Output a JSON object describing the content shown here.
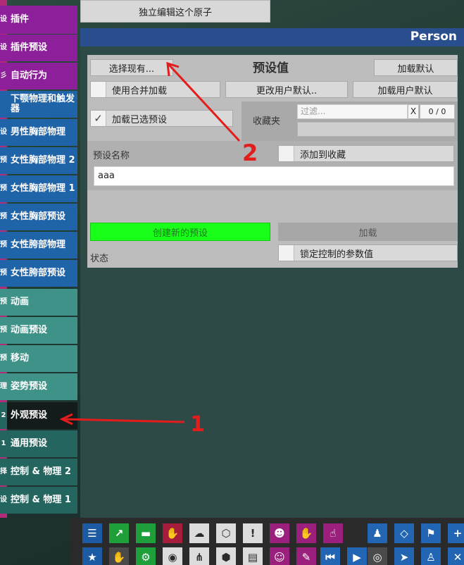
{
  "sidebar": {
    "items": [
      {
        "stub": "设",
        "label": "插件",
        "color": "purple"
      },
      {
        "stub": "设",
        "label": "插件预设",
        "color": "purple"
      },
      {
        "stub": "彡",
        "label": "自动行为",
        "color": "purple"
      },
      {
        "stub": "",
        "label": "下颚物理和触发器",
        "color": "blue"
      },
      {
        "stub": "设",
        "label": "男性胸部物理",
        "color": "blue"
      },
      {
        "stub": "预",
        "label": "女性胸部物理 2",
        "color": "blue"
      },
      {
        "stub": "预",
        "label": "女性胸部物理 1",
        "color": "blue"
      },
      {
        "stub": "预",
        "label": "女性胸部预设",
        "color": "blue"
      },
      {
        "stub": "预",
        "label": "女性胯部物理",
        "color": "blue"
      },
      {
        "stub": "预",
        "label": "女性胯部预设",
        "color": "blue"
      },
      {
        "stub": "预",
        "label": "动画",
        "color": "teal"
      },
      {
        "stub": "预",
        "label": "动画预设",
        "color": "teal"
      },
      {
        "stub": "预",
        "label": "移动",
        "color": "teal"
      },
      {
        "stub": "理",
        "label": "姿势预设",
        "color": "teal"
      },
      {
        "stub": "2",
        "label": "外观预设",
        "color": "dteal",
        "selected": true
      },
      {
        "stub": "1",
        "label": "通用预设",
        "color": "dteal"
      },
      {
        "stub": "择",
        "label": "控制 & 物理 2",
        "color": "dteal"
      },
      {
        "stub": "设",
        "label": "控制 & 物理 1",
        "color": "dteal"
      }
    ]
  },
  "top_button": "独立编辑这个原子",
  "panel": {
    "title": "Person",
    "section_title": "预设值",
    "select_existing": "选择现有...",
    "load_default": "加载默认",
    "use_merge_load": "使用合并加载",
    "change_user_default": "更改用户默认..",
    "load_user_default": "加载用户默认",
    "load_selected_preset": "加载已选预设",
    "load_selected_checked": "✓",
    "favorites_label": "收藏夹",
    "filter_placeholder": "过滤...",
    "filter_clear": "X",
    "filter_count": "0 / 0",
    "preset_name_label": "预设名称",
    "add_to_favorites": "添加到收藏",
    "preset_name_value": "aaa",
    "create_new_preset": "创建新的预设",
    "load_button": "加载",
    "status_label": "状态",
    "lock_params": "锁定控制的参数值"
  },
  "annotations": {
    "mark_1": "1",
    "mark_2": "2"
  },
  "toolbar": {
    "row1": [
      "menu-icon",
      "select-icon",
      "folder-icon",
      "hand-icon",
      "upload-icon",
      "box-icon",
      "alert-icon",
      "person-settings-icon",
      "grab-icon",
      "touch-icon",
      "person-icon",
      "unity-icon",
      "flag-icon",
      "plus-icon"
    ],
    "row2": [
      "star-icon",
      "hand-icon",
      "settings-icon",
      "camera-icon",
      "node-icon",
      "cube-icon",
      "document-icon",
      "user-icon",
      "tool-icon",
      "play-back-icon",
      "play-icon",
      "target-icon",
      "pointer-icon",
      "people-icon",
      "tools-icon"
    ]
  }
}
